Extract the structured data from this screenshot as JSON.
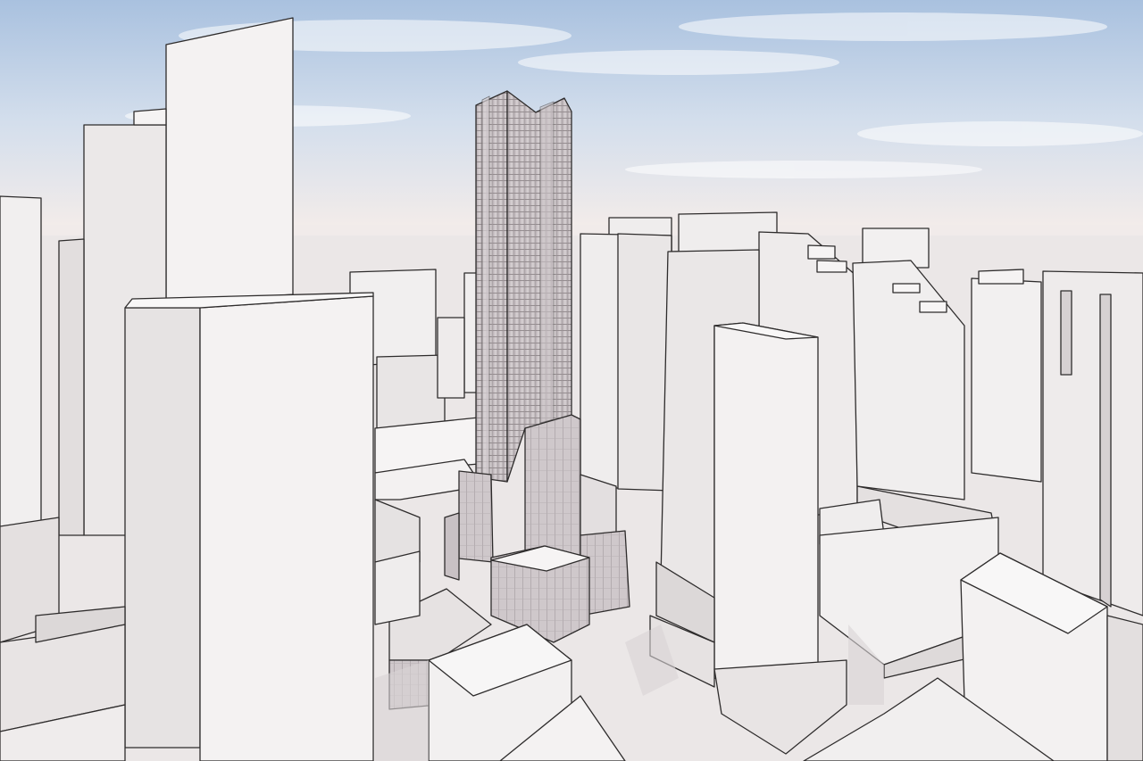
{
  "scene": {
    "kind": "architectural massing render",
    "colors": {
      "sky_top": "#a9c1df",
      "sky_mid": "#d3deec",
      "haze": "#f2eceb",
      "ground": "#e9e6e6",
      "mass_light": "#f6f4f4",
      "mass_mid": "#e7e3e3",
      "mass_shade": "#d4cfd0",
      "glass": "#c9c2c5",
      "outline": "#2e2c2c"
    }
  }
}
